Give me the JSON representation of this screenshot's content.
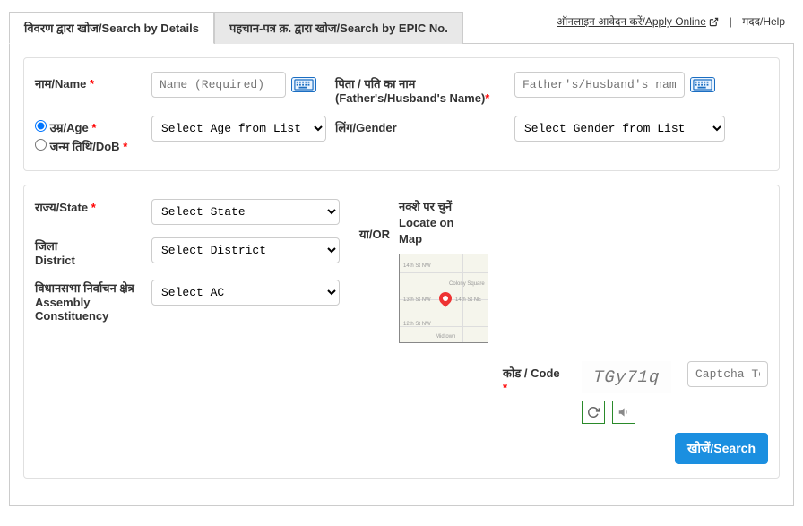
{
  "topLinks": {
    "apply": "ऑनलाइन आवेदन करें/Apply Online",
    "help": "मदद/Help"
  },
  "tabs": {
    "details": "विवरण द्वारा खोज/Search by Details",
    "epic": "पहचान-पत्र क्र. द्वारा खोज/Search by EPIC No."
  },
  "labels": {
    "name": "नाम/Name",
    "father": "पिता / पति का नाम",
    "father2": "(Father's/Husband's Name)",
    "age": "उम्र/Age",
    "dob": "जन्म तिथि/DoB",
    "gender": "लिंग/Gender",
    "state": "राज्य/State",
    "district_hi": "जिला",
    "district_en": "District",
    "ac_hi": "विधानसभा निर्वाचन क्षेत्र",
    "ac_en1": "Assembly",
    "ac_en2": "Constituency",
    "or": "या/OR",
    "map_hi": "नक्शे पर चुनें",
    "map_en1": "Locate on",
    "map_en2": "Map",
    "code": "कोड / Code"
  },
  "placeholders": {
    "name": "Name (Required)",
    "father": "Father's/Husband's name (optional)",
    "captcha": "Captcha Text"
  },
  "selects": {
    "age": "Select Age from List",
    "gender": "Select Gender from List",
    "state": "Select State",
    "district": "Select District",
    "ac": "Select AC"
  },
  "captcha": {
    "value": "TGy71q"
  },
  "buttons": {
    "search": "खोजें/Search"
  }
}
